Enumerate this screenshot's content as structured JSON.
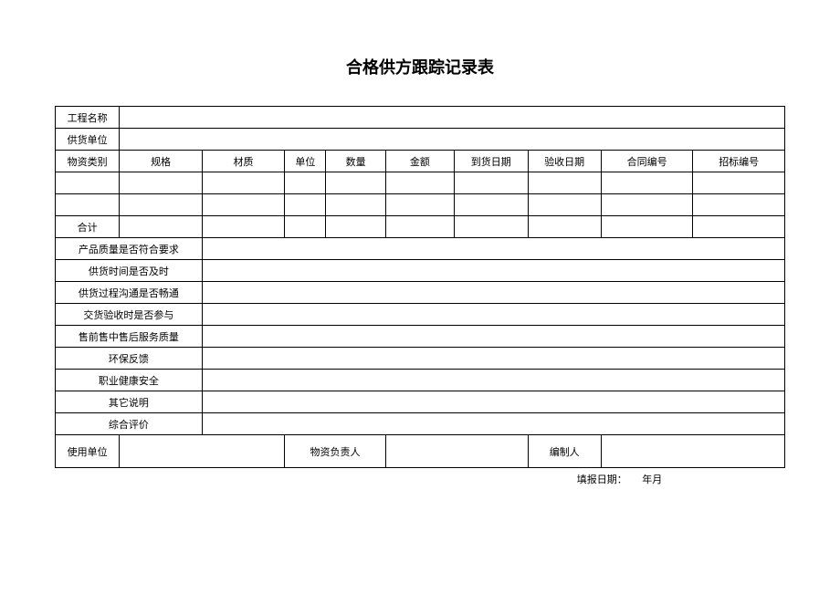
{
  "title": "合格供方跟踪记录表",
  "labels": {
    "project_name": "工程名称",
    "supplier_unit": "供货单位",
    "material_category": "物资类别",
    "spec": "规格",
    "material": "材质",
    "unit": "单位",
    "quantity": "数量",
    "amount": "金额",
    "arrival_date": "到货日期",
    "acceptance_date": "验收日期",
    "contract_no": "合同编号",
    "bid_no": "招标编号",
    "total": "合计",
    "q1": "产品质量是否符合要求",
    "q2": "供货时间是否及时",
    "q3": "供货过程沟通是否畅通",
    "q4": "交货验收时是否参与",
    "q5": "售前售中售后服务质量",
    "q6": "环保反馈",
    "q7": "职业健康安全",
    "q8": "其它说明",
    "q9": "综合评价",
    "using_unit": "使用单位",
    "material_leader": "物资负责人",
    "preparer": "编制人",
    "fill_date": "填报日期：",
    "year_month": "年月"
  }
}
